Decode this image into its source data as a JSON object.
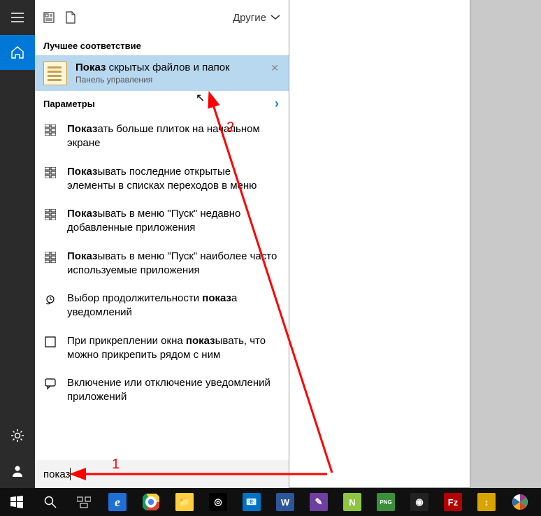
{
  "toolbar": {
    "filter_label": "Другие"
  },
  "rail": {
    "hamburger": "menu",
    "home": "home",
    "settings": "settings",
    "user": "user"
  },
  "sections": {
    "best_match": "Лучшее соответствие",
    "settings": "Параметры"
  },
  "best_match": {
    "title_bold": "Показ",
    "title_rest": " скрытых файлов и папок",
    "subtitle": "Панель управления"
  },
  "results": [
    {
      "icon": "tiles",
      "bold": "Показ",
      "rest": "ать больше плиток на начальном экране"
    },
    {
      "icon": "tiles",
      "bold": "Показ",
      "rest": "ывать последние открытые элементы в списках переходов в меню"
    },
    {
      "icon": "tiles",
      "bold": "Показ",
      "rest": "ывать в меню \"Пуск\" недавно добавленные приложения"
    },
    {
      "icon": "tiles",
      "bold": "Показ",
      "rest": "ывать в меню \"Пуск\" наиболее часто используемые приложения"
    },
    {
      "icon": "clock",
      "pre": "Выбор продолжительности ",
      "bold": "показ",
      "rest": "а уведомлений"
    },
    {
      "icon": "square",
      "pre": "При прикреплении окна ",
      "bold": "показ",
      "rest": "ывать, что можно прикрепить рядом с ним"
    },
    {
      "icon": "balloon",
      "pre": "Включение или отключение уведомлений приложений",
      "bold": "",
      "rest": ""
    }
  ],
  "search": {
    "query": "показ"
  },
  "annotations": {
    "label1": "1",
    "label2": "2"
  },
  "taskbar": {
    "apps": [
      {
        "name": "start",
        "glyph": "win",
        "bg": ""
      },
      {
        "name": "search",
        "glyph": "search",
        "bg": ""
      },
      {
        "name": "taskview",
        "glyph": "taskview",
        "bg": ""
      },
      {
        "name": "ie",
        "glyph": "e",
        "bg": "#1e6fd6"
      },
      {
        "name": "chrome",
        "glyph": "●",
        "bg": "chrome"
      },
      {
        "name": "explorer",
        "glyph": "📁",
        "bg": "#ffcf3f"
      },
      {
        "name": "aimp",
        "glyph": "◎",
        "bg": "#000"
      },
      {
        "name": "outlook",
        "glyph": "📧",
        "bg": "#0072c6"
      },
      {
        "name": "word",
        "glyph": "W",
        "bg": "#2b579a"
      },
      {
        "name": "lightshot",
        "glyph": "✎",
        "bg": "#6d3fa0"
      },
      {
        "name": "notepadpp",
        "glyph": "N",
        "bg": "#8ec641"
      },
      {
        "name": "png",
        "glyph": "PNG",
        "bg": "#3a8f3a"
      },
      {
        "name": "obs",
        "glyph": "◉",
        "bg": "#222"
      },
      {
        "name": "filezilla",
        "glyph": "Fz",
        "bg": "#b30000"
      },
      {
        "name": "winscp",
        "glyph": "↕",
        "bg": "#d9a300"
      },
      {
        "name": "picasa",
        "glyph": "◐",
        "bg": "picasa"
      }
    ]
  }
}
